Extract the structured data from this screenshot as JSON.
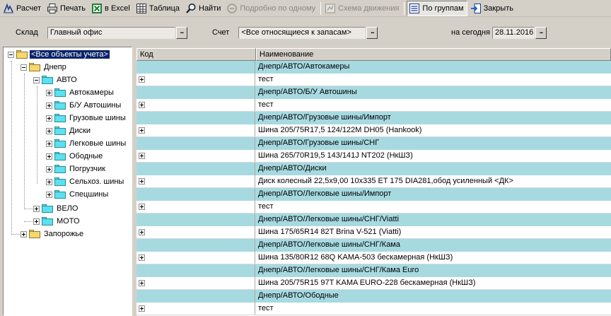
{
  "toolbar": {
    "raschet": "Расчет",
    "pechat": "Печать",
    "excel": "в Excel",
    "tablica": "Таблица",
    "nayti": "Найти",
    "podrobno": "Подробно по одному",
    "shema": "Схема движения",
    "po_gruppam": "По группам",
    "zakryt": "Закрыть"
  },
  "filters": {
    "sklad_label": "Склад",
    "sklad_value": "Главный офис",
    "schet_label": "Счет",
    "schet_value": "<Все относящиеся к запасам>",
    "date_label": "на сегодня",
    "date_value": "28.11.2016",
    "more": "..."
  },
  "tree": {
    "root": "<Все объекты учета>",
    "dnepr": "Днепр",
    "avto": "АВТО",
    "avtokamery": "Автокамеры",
    "bu_avtoshiny": "Б/У Автошины",
    "gruzovye": "Грузовые шины",
    "diski": "Диски",
    "legkovye": "Легковые шины",
    "obodnye": "Ободные",
    "pogruzchik": "Погрузчик",
    "selhoz": "Сельхоз. шины",
    "specshiny": "Спецшины",
    "velo": "ВЕЛО",
    "moto": "МОТО",
    "zaporozhye": "Запорожье"
  },
  "grid": {
    "col_kod": "Код",
    "col_name": "Наименование",
    "rows": [
      {
        "type": "group",
        "name": "Днепр/АВТО/Автокамеры"
      },
      {
        "type": "item",
        "name": "тест"
      },
      {
        "type": "group",
        "name": "Днепр/АВТО/Б/У Автошины"
      },
      {
        "type": "item",
        "name": "тест"
      },
      {
        "type": "group",
        "name": "Днепр/АВТО/Грузовые шины/Импорт"
      },
      {
        "type": "item",
        "name": "Шина 205/75R17,5 124/122M DH05 (Hankook)"
      },
      {
        "type": "group",
        "name": "Днепр/АВТО/Грузовые шины/СНГ"
      },
      {
        "type": "item",
        "name": "Шина 265/70R19,5 143/141J NT202 (НкШЗ)"
      },
      {
        "type": "group",
        "name": "Днепр/АВТО/Диски"
      },
      {
        "type": "item",
        "name": "Диск колесный  22,5x9,00 10x335 ET 175 DIA281,обод усиленный <ДК>"
      },
      {
        "type": "group",
        "name": "Днепр/АВТО/Легковые шины/Импорт"
      },
      {
        "type": "item",
        "name": "тест"
      },
      {
        "type": "group",
        "name": "Днепр/АВТО/Легковые шины/СНГ/Viatti"
      },
      {
        "type": "item",
        "name": "Шина 175/65R14 82T Brina V-521 (Viatti)"
      },
      {
        "type": "group",
        "name": "Днепр/АВТО/Легковые шины/СНГ/Кама"
      },
      {
        "type": "item",
        "name": "Шина 135/80R12 68Q KAMA-503 бескамерная (НкШЗ)"
      },
      {
        "type": "group",
        "name": "Днепр/АВТО/Легковые шины/СНГ/Кама Euro"
      },
      {
        "type": "item",
        "name": "Шина 205/75R15 97T KAMA EURO-228 бескамерная (НкШЗ)"
      },
      {
        "type": "group",
        "name": "Днепр/АВТО/Ободные"
      },
      {
        "type": "item",
        "name": "тест"
      }
    ]
  }
}
